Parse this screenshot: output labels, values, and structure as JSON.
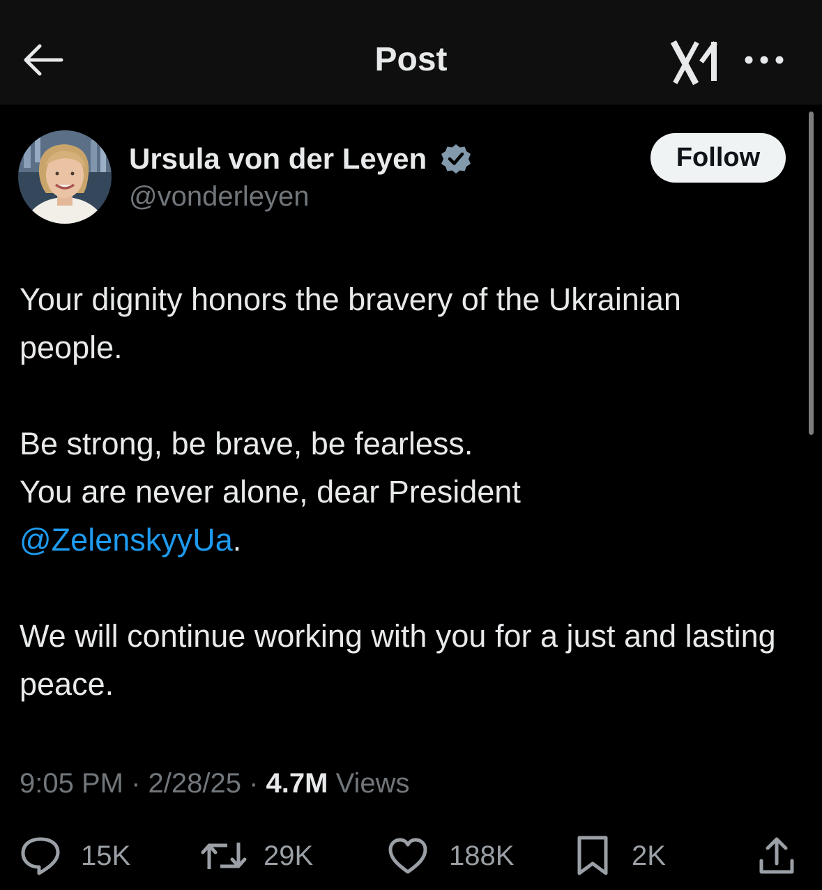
{
  "header": {
    "title": "Post",
    "back_icon": "arrow-left-icon",
    "grok_icon": "grok-icon",
    "more_icon": "more-horizontal-icon"
  },
  "author": {
    "display_name": "Ursula von der Leyen",
    "handle": "@vonderleyen",
    "verified_icon": "verified-badge-icon",
    "follow_label": "Follow"
  },
  "post": {
    "paragraph1": "Your dignity honors the bravery of the Ukrainian people.",
    "line2a": "Be strong, be brave, be fearless.",
    "line2b": "You are never alone, dear President",
    "mention": "@ZelenskyyUa",
    "mention_suffix": ".",
    "paragraph3": "We will continue working with you for a just and lasting peace."
  },
  "meta": {
    "time": "9:05 PM",
    "sep1": " · ",
    "date": "2/28/25",
    "sep2": " · ",
    "views_count": "4.7M",
    "views_label": " Views"
  },
  "actions": {
    "replies": "15K",
    "reposts": "29K",
    "likes": "188K",
    "bookmarks": "2K",
    "share_icon": "share-icon"
  },
  "colors": {
    "background": "#000000",
    "header_background": "#0f0f0f",
    "text": "#e7e9ea",
    "secondary_text": "#71767b",
    "link": "#1d9bf0",
    "verified": "#829aab",
    "follow_button": "#eff3f4"
  }
}
